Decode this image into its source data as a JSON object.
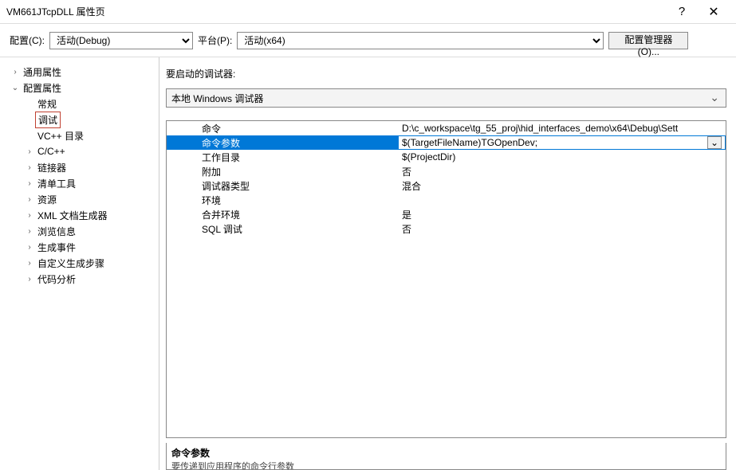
{
  "titlebar": {
    "title": "VM661JTcpDLL 属性页"
  },
  "toolbar": {
    "config_label": "配置(C):",
    "config_value": "活动(Debug)",
    "platform_label": "平台(P):",
    "platform_value": "活动(x64)",
    "manager_label": "配置管理器(O)..."
  },
  "tree": {
    "nodes": [
      {
        "label": "通用属性",
        "depth": 0,
        "expander": "›"
      },
      {
        "label": "配置属性",
        "depth": 0,
        "expander": "⌄"
      },
      {
        "label": "常规",
        "depth": 1,
        "expander": ""
      },
      {
        "label": "调试",
        "depth": 1,
        "expander": "",
        "highlighted": true
      },
      {
        "label": "VC++ 目录",
        "depth": 1,
        "expander": ""
      },
      {
        "label": "C/C++",
        "depth": 1,
        "expander": "›"
      },
      {
        "label": "链接器",
        "depth": 1,
        "expander": "›"
      },
      {
        "label": "清单工具",
        "depth": 1,
        "expander": "›"
      },
      {
        "label": "资源",
        "depth": 1,
        "expander": "›"
      },
      {
        "label": "XML 文档生成器",
        "depth": 1,
        "expander": "›"
      },
      {
        "label": "浏览信息",
        "depth": 1,
        "expander": "›"
      },
      {
        "label": "生成事件",
        "depth": 1,
        "expander": "›"
      },
      {
        "label": "自定义生成步骤",
        "depth": 1,
        "expander": "›"
      },
      {
        "label": "代码分析",
        "depth": 1,
        "expander": "›"
      }
    ]
  },
  "right": {
    "heading": "要启动的调试器:",
    "debugger_value": "本地 Windows 调试器",
    "grid_rows": [
      {
        "label": "命令",
        "value": "D:\\c_workspace\\tg_55_proj\\hid_interfaces_demo\\x64\\Debug\\Sett"
      },
      {
        "label": "命令参数",
        "value": "$(TargetFileName)TGOpenDev;",
        "selected": true
      },
      {
        "label": "工作目录",
        "value": "$(ProjectDir)"
      },
      {
        "label": "附加",
        "value": "否"
      },
      {
        "label": "调试器类型",
        "value": "混合"
      },
      {
        "label": "环境",
        "value": ""
      },
      {
        "label": "合并环境",
        "value": "是"
      },
      {
        "label": "SQL 调试",
        "value": "否"
      }
    ],
    "desc_title": "命令参数",
    "desc_text": "要传递到应用程序的命令行参数"
  }
}
